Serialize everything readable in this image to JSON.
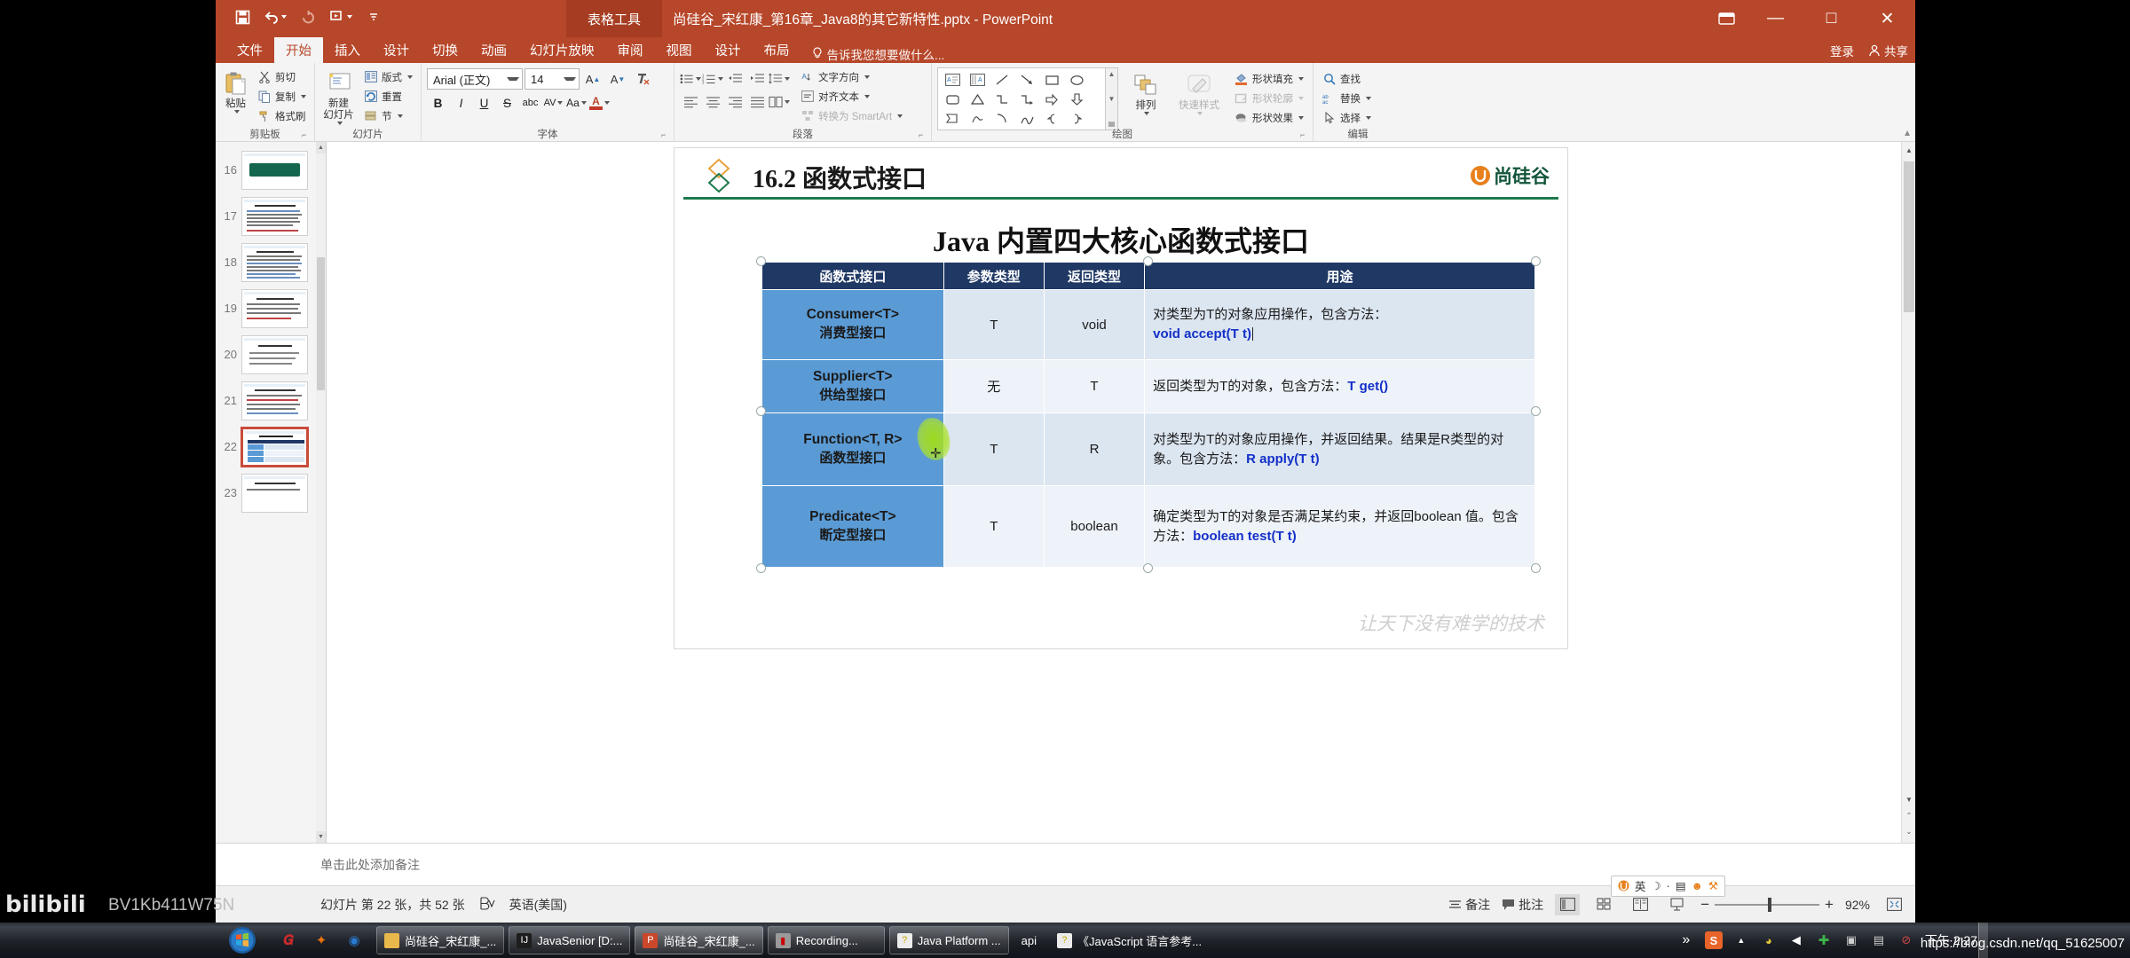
{
  "window": {
    "context_tab": "表格工具",
    "doc_title": "尚硅谷_宋红康_第16章_Java8的其它新特性.pptx - PowerPoint",
    "minimize": "―",
    "maximize": "□",
    "close": "✕",
    "ribbon_display_icon": "ribbon-display-options-icon"
  },
  "quick_access": [
    {
      "name": "save-icon",
      "label": "保存"
    },
    {
      "name": "undo-icon",
      "label": "撤销"
    },
    {
      "name": "redo-icon",
      "label": "重复"
    },
    {
      "name": "start-slideshow-icon",
      "label": "从头开始"
    },
    {
      "name": "customize-qat-icon",
      "label": "自定义快速访问工具栏"
    }
  ],
  "tabs": [
    {
      "label": "文件",
      "active": false
    },
    {
      "label": "开始",
      "active": true
    },
    {
      "label": "插入",
      "active": false
    },
    {
      "label": "设计",
      "active": false
    },
    {
      "label": "切换",
      "active": false
    },
    {
      "label": "动画",
      "active": false
    },
    {
      "label": "幻灯片放映",
      "active": false
    },
    {
      "label": "审阅",
      "active": false
    },
    {
      "label": "视图",
      "active": false
    },
    {
      "label": "设计",
      "active": false
    },
    {
      "label": "布局",
      "active": false
    }
  ],
  "tell_me": "告诉我您想要做什么...",
  "account": {
    "signin": "登录",
    "share": "共享"
  },
  "ribbon": {
    "groups": [
      {
        "name": "剪贴板",
        "big": {
          "label": "粘贴",
          "icon": "paste-icon"
        },
        "items": [
          {
            "label": "剪切",
            "icon": "cut-icon"
          },
          {
            "label": "复制",
            "icon": "copy-icon"
          },
          {
            "label": "格式刷",
            "icon": "format-painter-icon"
          }
        ]
      },
      {
        "name": "幻灯片",
        "big": {
          "label": "新建\n幻灯片",
          "icon": "new-slide-icon"
        },
        "items": [
          {
            "label": "版式",
            "icon": "layout-icon"
          },
          {
            "label": "重置",
            "icon": "reset-icon"
          },
          {
            "label": "节",
            "icon": "section-icon"
          }
        ]
      },
      {
        "name": "字体",
        "font_name": "Arial (正文)",
        "font_size": "14",
        "grow": "A",
        "shrink": "A",
        "clear_format": "clear-formatting-icon",
        "buttons": [
          "B",
          "I",
          "U",
          "S",
          "abc",
          "AV",
          "Aa",
          "A"
        ]
      },
      {
        "name": "段落",
        "items": [
          {
            "label": "文字方向",
            "icon": "text-direction-icon"
          },
          {
            "label": "对齐文本",
            "icon": "align-text-icon"
          },
          {
            "label": "转换为 SmartArt",
            "icon": "smartart-icon"
          }
        ]
      },
      {
        "name": "绘图",
        "items": [
          {
            "label": "排列",
            "icon": "arrange-icon"
          },
          {
            "label": "快速样式",
            "icon": "quick-styles-icon"
          },
          {
            "label": "形状填充",
            "icon": "shape-fill-icon"
          },
          {
            "label": "形状轮廓",
            "icon": "shape-outline-icon"
          },
          {
            "label": "形状效果",
            "icon": "shape-effects-icon"
          }
        ]
      },
      {
        "name": "编辑",
        "items": [
          {
            "label": "查找",
            "icon": "find-icon"
          },
          {
            "label": "替换",
            "icon": "replace-icon"
          },
          {
            "label": "选择",
            "icon": "select-icon"
          }
        ]
      }
    ]
  },
  "thumbnails": [
    {
      "number": "16",
      "selected": false,
      "kind": "green"
    },
    {
      "number": "17",
      "selected": false,
      "kind": "text"
    },
    {
      "number": "18",
      "selected": false,
      "kind": "text"
    },
    {
      "number": "19",
      "selected": false,
      "kind": "text"
    },
    {
      "number": "20",
      "selected": false,
      "kind": "text"
    },
    {
      "number": "21",
      "selected": false,
      "kind": "text"
    },
    {
      "number": "22",
      "selected": true,
      "kind": "table"
    },
    {
      "number": "23",
      "selected": false,
      "kind": "text"
    }
  ],
  "slide": {
    "section_number": "16.2",
    "section_title": "函数式接口",
    "brand": "尚硅谷",
    "heading_en": "Java",
    "heading_cn": "内置四大核心函数式接口",
    "watermark": "让天下没有难学的技术",
    "table": {
      "headers": [
        "函数式接口",
        "参数类型",
        "返回类型",
        "用途"
      ],
      "rows": [
        {
          "interface_en": "Consumer<T>",
          "interface_cn": "消费型接口",
          "param": "T",
          "ret": "void",
          "desc_pre": "对类型为T的对象应用操作，包含方法：",
          "desc_code": "void accept(T t)",
          "desc_post": "",
          "code_first": false,
          "caret": true
        },
        {
          "interface_en": "Supplier<T>",
          "interface_cn": "供给型接口",
          "param": "无",
          "ret": "T",
          "desc_pre": "返回类型为T的对象，包含方法：",
          "desc_code": "T get()",
          "desc_post": "",
          "code_first": false,
          "caret": false
        },
        {
          "interface_en": "Function<T, R>",
          "interface_cn": "函数型接口",
          "param": "T",
          "ret": "R",
          "desc_pre": "对类型为T的对象应用操作，并返回结果。结果是R类型的对象。包含方法：",
          "desc_code": "R apply(T t)",
          "desc_post": "",
          "code_first": false,
          "caret": false
        },
        {
          "interface_en": "Predicate<T>",
          "interface_cn": "断定型接口",
          "param": "T",
          "ret": "boolean",
          "desc_pre": "确定类型为T的对象是否满足某约束，并返回boolean 值。包含方法：",
          "desc_code": "boolean test(T t)",
          "desc_post": "",
          "code_first": false,
          "caret": false
        }
      ]
    }
  },
  "notes": {
    "placeholder": "单击此处添加备注"
  },
  "status": {
    "slide_counter": "幻灯片 第 22 张，共 52 张",
    "spellcheck_icon": "spellcheck-icon",
    "language": "英语(美国)",
    "notes_button": "备注",
    "comments_button": "批注",
    "views": [
      {
        "name": "normal-view",
        "icon": "normal-view-icon",
        "active": true
      },
      {
        "name": "slide-sorter-view",
        "icon": "slide-sorter-icon",
        "active": false
      },
      {
        "name": "reading-view",
        "icon": "reading-view-icon",
        "active": false
      },
      {
        "name": "slideshow-view",
        "icon": "slideshow-icon",
        "active": false
      }
    ],
    "zoom_out": "−",
    "zoom_in": "+",
    "zoom_level": "92%",
    "fit_slide_icon": "fit-to-window-icon"
  },
  "ime": {
    "lang": "英",
    "items": [
      "moon-icon",
      "dot-icon",
      "keyboard-icon",
      "user-icon",
      "tools-icon"
    ]
  },
  "taskbar": {
    "start": "start-orb-icon",
    "quicklaunch": [
      {
        "name": "opera-icon",
        "glyph": "O",
        "color": "#cc2b2b"
      },
      {
        "name": "firefox-icon",
        "glyph": "✦",
        "color": "#e8720c"
      },
      {
        "name": "chrome-icon",
        "glyph": "◉",
        "color": "#2a7bd0"
      }
    ],
    "buttons": [
      {
        "label": "尚硅谷_宋红康_...",
        "icon": "folder-icon",
        "color": "#e8b84b"
      },
      {
        "label": "JavaSenior [D:...",
        "icon": "intellij-icon",
        "color": "#1d1d1d"
      },
      {
        "label": "尚硅谷_宋红康_...",
        "icon": "powerpoint-icon",
        "color": "#c9472b",
        "active": true
      },
      {
        "label": "Recording...",
        "icon": "recorder-icon",
        "color": "#9a9a9a"
      },
      {
        "label": "Java Platform ...",
        "icon": "help-icon",
        "color": "#d8d8d8"
      },
      {
        "label": "api",
        "icon": "help-icon",
        "color": "#d8d8d8",
        "plain": true
      },
      {
        "label": "《JavaScript 语言参考...",
        "icon": "help-icon",
        "color": "#d8d8d8",
        "plain": true
      }
    ],
    "overflow": "»",
    "tray": [
      {
        "name": "sogou-ime-icon",
        "glyph": "S",
        "color": "#e8642a"
      },
      {
        "name": "show-hidden-icons-icon",
        "glyph": "▲",
        "color": "#cfcfcf"
      },
      {
        "name": "network-icon",
        "glyph": "◕",
        "color": "#d8c23a"
      },
      {
        "name": "volume-icon",
        "glyph": "◀",
        "color": "#e8e8e8"
      },
      {
        "name": "security-icon",
        "glyph": "✚",
        "color": "#3cb54a"
      },
      {
        "name": "safe-remove-icon",
        "glyph": "▣",
        "color": "#c8c8c8"
      },
      {
        "name": "clipboard-tool-icon",
        "glyph": "▤",
        "color": "#cccccc"
      },
      {
        "name": "block-icon",
        "glyph": "⊘",
        "color": "#c03a3a"
      }
    ],
    "clock": "下午 2:27"
  },
  "overlay": {
    "bilibili": "bilibili",
    "bvid": "BV1Kb411W75N",
    "url": "https://blog.csdn.net/qq_51625007"
  }
}
